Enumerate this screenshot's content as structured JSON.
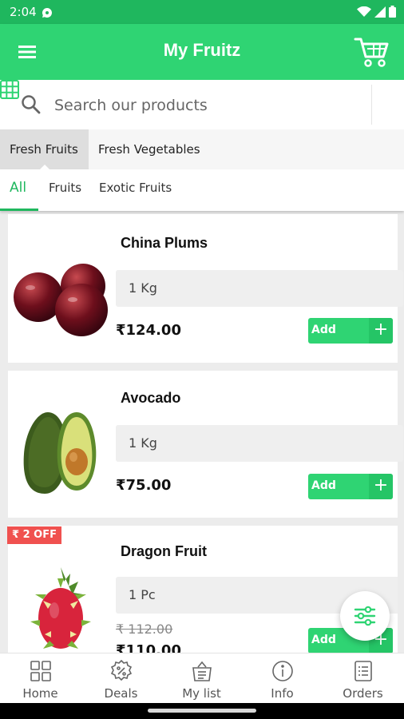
{
  "status_bar": {
    "time": "2:04"
  },
  "app_bar": {
    "title": "My Fruitz"
  },
  "search": {
    "placeholder": "Search our products"
  },
  "category_tabs": [
    {
      "label": "Fresh Fruits",
      "active": true
    },
    {
      "label": "Fresh Vegetables",
      "active": false
    }
  ],
  "sub_tabs": [
    {
      "label": "All",
      "active": true
    },
    {
      "label": "Fruits",
      "active": false
    },
    {
      "label": "Exotic Fruits",
      "active": false
    }
  ],
  "products": [
    {
      "name": "China Plums",
      "size": "1 Kg",
      "price": "₹124.00",
      "add_label": "Add"
    },
    {
      "name": "Avocado",
      "size": "1 Kg",
      "price": "₹75.00",
      "add_label": "Add"
    },
    {
      "name": "Dragon Fruit",
      "size": "1 Pc",
      "old_price": "₹ 112.00",
      "price": "₹110.00",
      "badge": "₹ 2 OFF",
      "add_label": "Add"
    }
  ],
  "bottom_nav": [
    {
      "label": "Home",
      "icon": "grid-icon"
    },
    {
      "label": "Deals",
      "icon": "percent-badge-icon"
    },
    {
      "label": "My list",
      "icon": "basket-list-icon"
    },
    {
      "label": "Info",
      "icon": "info-icon"
    },
    {
      "label": "Orders",
      "icon": "orders-list-icon"
    }
  ],
  "colors": {
    "primary": "#2fd473",
    "status": "#1fb75e",
    "badge": "#f0514f"
  }
}
